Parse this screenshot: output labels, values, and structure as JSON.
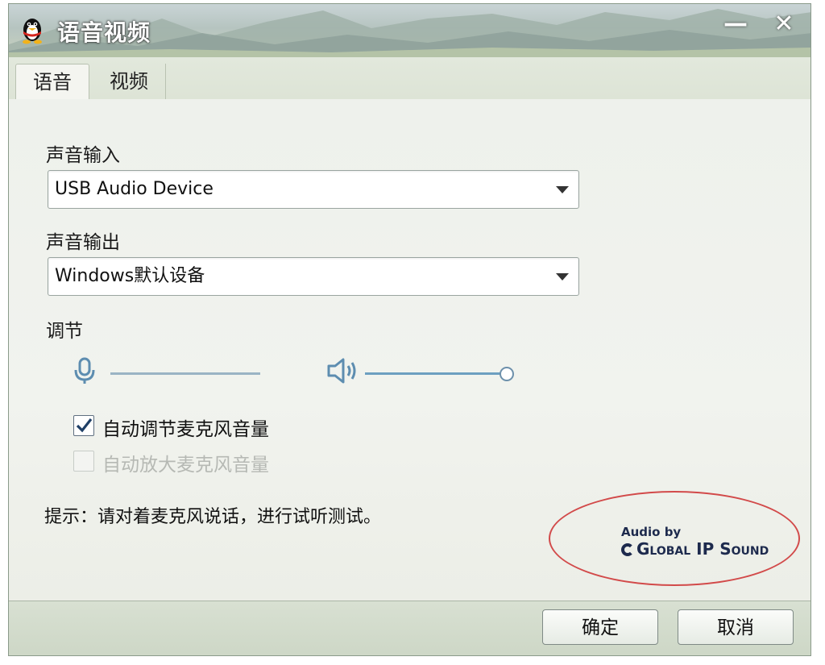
{
  "window": {
    "title": "语音视频",
    "icon": "qq-penguin-icon",
    "minimize_glyph": "—",
    "close_glyph": "✕"
  },
  "tabs": [
    {
      "label": "语音",
      "active": true
    },
    {
      "label": "视频",
      "active": false
    }
  ],
  "audio_input": {
    "label": "声音输入",
    "selected": "USB Audio Device"
  },
  "audio_output": {
    "label": "声音输出",
    "selected": "Windows默认设备"
  },
  "adjust": {
    "label": "调节",
    "mic_icon": "microphone-icon",
    "speaker_icon": "speaker-icon",
    "speaker_volume_fraction": 1.0
  },
  "checkboxes": [
    {
      "label": "自动调节麦克风音量",
      "checked": true,
      "enabled": true
    },
    {
      "label": "自动放大麦克风音量",
      "checked": false,
      "enabled": false
    }
  ],
  "hint": "提示：请对着麦克风说话，进行试听测试。",
  "branding": {
    "audio_by": "Audio by",
    "name": "Global IP Sound"
  },
  "buttons": {
    "ok": "确定",
    "cancel": "取消"
  },
  "colors": {
    "highlight_ellipse": "#d24a4a",
    "slider_track": "#6d9fc0"
  }
}
